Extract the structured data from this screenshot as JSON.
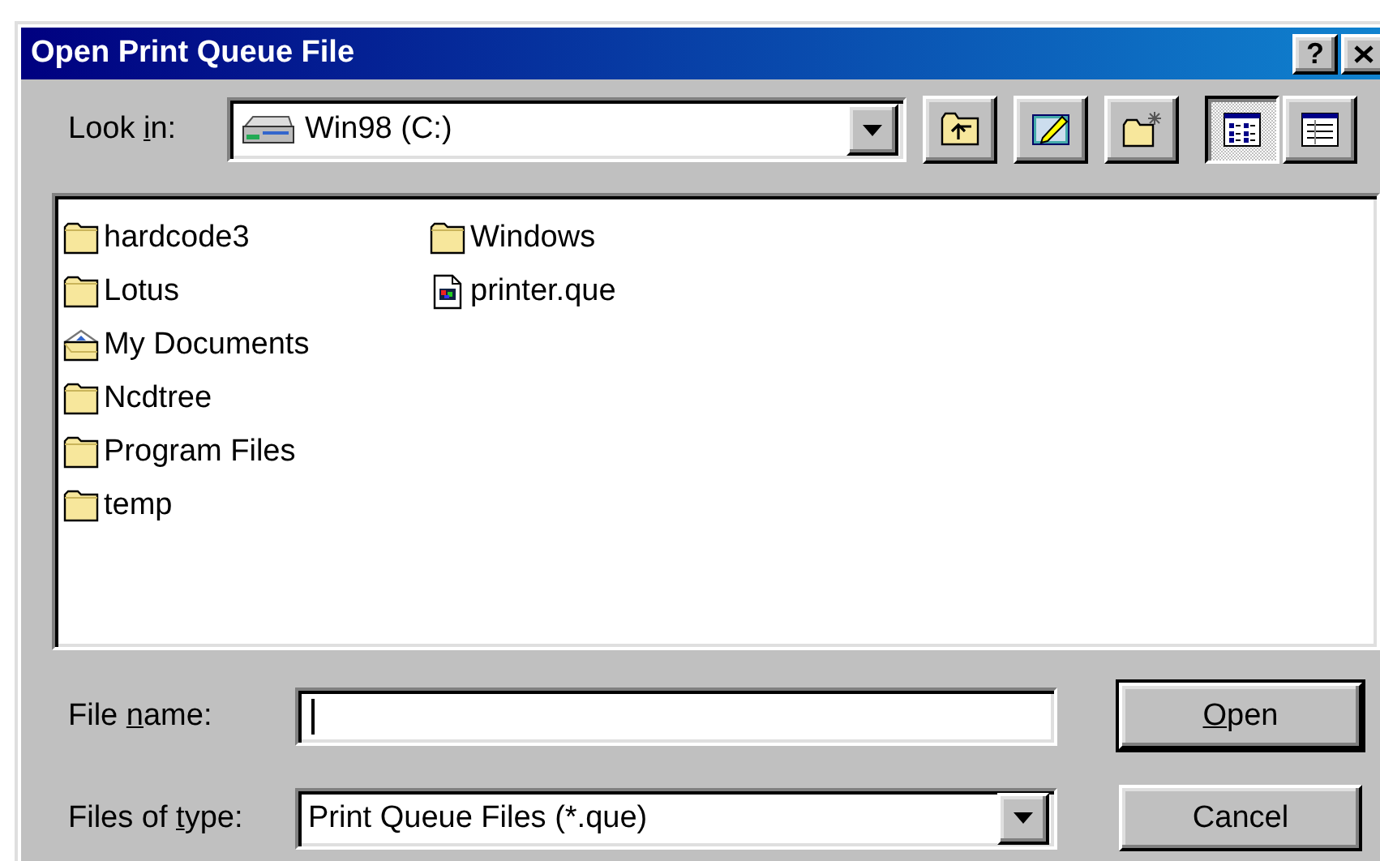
{
  "window": {
    "title": "Open Print Queue File",
    "help_button": "?"
  },
  "look_in": {
    "label": {
      "before": "Look ",
      "key": "i",
      "after": "n:"
    },
    "value": "Win98 (C:)"
  },
  "view_modes": [
    {
      "kind": "list",
      "selected": true
    },
    {
      "kind": "details",
      "selected": false
    }
  ],
  "files": [
    {
      "name": "hardcode3",
      "kind": "folder"
    },
    {
      "name": "Lotus",
      "kind": "folder"
    },
    {
      "name": "My Documents",
      "kind": "documents"
    },
    {
      "name": "Ncdtree",
      "kind": "folder"
    },
    {
      "name": "Program Files",
      "kind": "folder"
    },
    {
      "name": "temp",
      "kind": "folder"
    },
    {
      "name": "Windows",
      "kind": "folder"
    },
    {
      "name": "printer.que",
      "kind": "file"
    }
  ],
  "file_name": {
    "label": {
      "before": "File ",
      "key": "n",
      "after": "ame:"
    },
    "focused": true
  },
  "file_type": {
    "label": {
      "before": "Files of ",
      "key": "t",
      "after": "ype:"
    },
    "value": "Print Queue Files (*.que)"
  },
  "buttons": [
    {
      "label": {
        "key": "O",
        "after": "pen"
      },
      "default": true
    },
    {
      "label": {
        "before": "Cancel"
      },
      "default": false
    }
  ]
}
